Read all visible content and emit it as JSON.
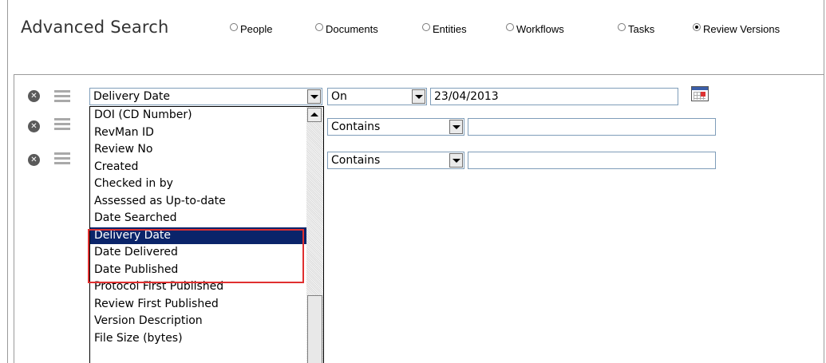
{
  "header": {
    "title": "Advanced Search",
    "search_types": [
      {
        "label": "People",
        "selected": false
      },
      {
        "label": "Documents",
        "selected": false
      },
      {
        "label": "Entities",
        "selected": false
      },
      {
        "label": "Workflows",
        "selected": false
      },
      {
        "label": "Tasks",
        "selected": false
      },
      {
        "label": "Review Versions",
        "selected": true
      }
    ]
  },
  "criteria": [
    {
      "field": "Delivery Date",
      "operator": "On",
      "value": "23/04/2013"
    },
    {
      "field": "",
      "operator": "Contains",
      "value": ""
    },
    {
      "field": "",
      "operator": "Contains",
      "value": ""
    }
  ],
  "field_dropdown": {
    "options": [
      "DOI (CD Number)",
      "RevMan ID",
      "Review No",
      "Created",
      "Checked in by",
      "Assessed as Up-to-date",
      "Date Searched",
      "Delivery Date",
      "Date Delivered",
      "Date Published",
      "Protocol First Published",
      "Review First Published",
      "Version Description",
      "File Size (bytes)"
    ],
    "selected": "Delivery Date",
    "highlight_color": "#e03030",
    "selection_color": "#0a246a"
  }
}
